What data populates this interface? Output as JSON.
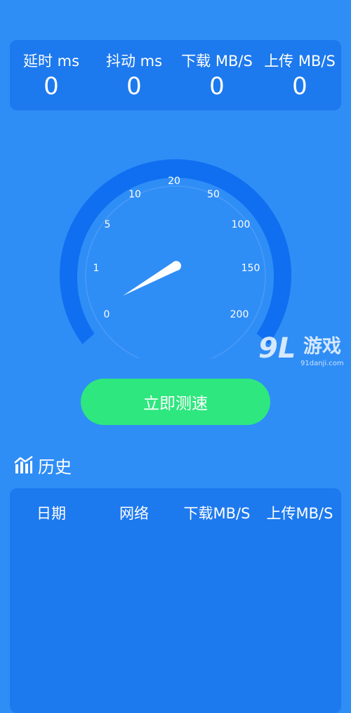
{
  "stats": [
    {
      "label": "延时  ms",
      "value": "0"
    },
    {
      "label": "抖动  ms",
      "value": "0"
    },
    {
      "label": "下载  MB/S",
      "value": "0"
    },
    {
      "label": "上传  MB/S",
      "value": "0"
    }
  ],
  "gauge": {
    "ticks": [
      "0",
      "1",
      "5",
      "10",
      "20",
      "50",
      "100",
      "150",
      "200"
    ],
    "needle_value": 0
  },
  "watermark": {
    "logo": "9L",
    "text": "游戏",
    "url": "91danji.com"
  },
  "test_button": {
    "label": "立即测速"
  },
  "history": {
    "title": "历史",
    "columns": [
      "日期",
      "网络",
      "下载MB/S",
      "上传MB/S"
    ]
  },
  "colors": {
    "background": "#2f8df6",
    "card": "#1d79ee",
    "gauge_arc": "#0f6ff0",
    "gauge_face": "#2f8df6",
    "button": "#2ee77e",
    "text": "#ffffff"
  }
}
